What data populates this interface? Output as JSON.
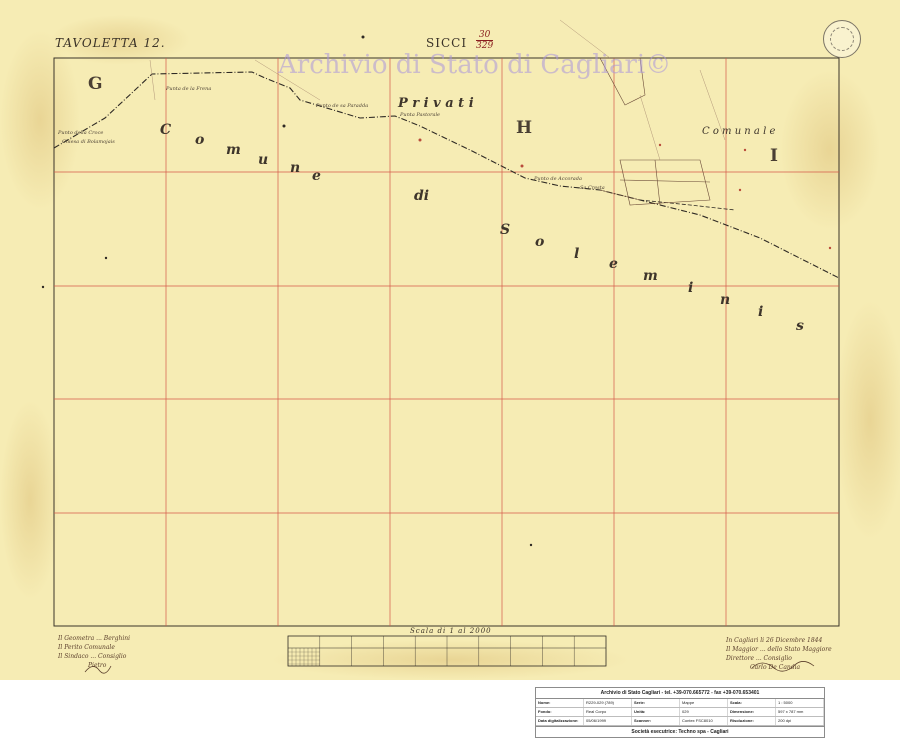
{
  "map": {
    "tavoletta": "TAVOLETTA 12.",
    "sicci": "SICCI",
    "sicci_fraction_top": "30",
    "sicci_fraction_bottom": "329",
    "watermark": "Archivio di Stato di Cagliari©",
    "zone_g": "G",
    "zone_h": "H",
    "zone_i": "I",
    "comune_words": [
      "C",
      "o",
      "m",
      "u",
      "n",
      "e",
      "di",
      "S",
      "o",
      "l",
      "e",
      "m",
      "i",
      "n",
      "i",
      "s"
    ],
    "privati": "P r i v a t i",
    "comunale": "C o m u n a l e",
    "places": {
      "chiesa": "Chiesa di Bolamojais",
      "punto_croce": "Punto della Croce",
      "punta_frena": "Punta de la Frena",
      "punto_paradda": "Punto de sa Paradda",
      "punta_pastorale": "Punta Pastorale",
      "punto_accorada": "Punto de Accorada",
      "sa_cresta": "Sa Cresta"
    },
    "scale_title": "Scala di 1 al 2000",
    "signature_left": [
      "Il Geometra ... Berghini",
      "Il Perito Comunale",
      "Il Sindaco ... Consiglio",
      "Pietro"
    ],
    "signature_right": [
      "In Cagliari li 26 Dicembre 1844",
      "Il Maggior ... dello Stato Maggiore",
      "Direttore ... Consiglio",
      "Carlo De Candia"
    ]
  },
  "infobox": {
    "header": "Archivio di Stato Cagliari - tel. +39-070.665772 - fax +39-070.653401",
    "rows": [
      [
        {
          "k": "Nome:",
          "v": "R229-029 (789)"
        },
        {
          "k": "Serie:",
          "v": "Mappe"
        },
        {
          "k": "Scala:",
          "v": "1 : 5000"
        }
      ],
      [
        {
          "k": "Fondo:",
          "v": "Real Corpo"
        },
        {
          "k": "Unità:",
          "v": "029"
        },
        {
          "k": "Dimensione:",
          "v": "597 x 787 mm"
        }
      ],
      [
        {
          "k": "Data digitalizzazione:",
          "v": "05/06/1999"
        },
        {
          "k": "Scanner:",
          "v": "Contex FSC8010"
        },
        {
          "k": "Risoluzione:",
          "v": "200 dpi"
        }
      ]
    ],
    "footer": "Società esecutrice: Techno spa - Cagliari"
  }
}
